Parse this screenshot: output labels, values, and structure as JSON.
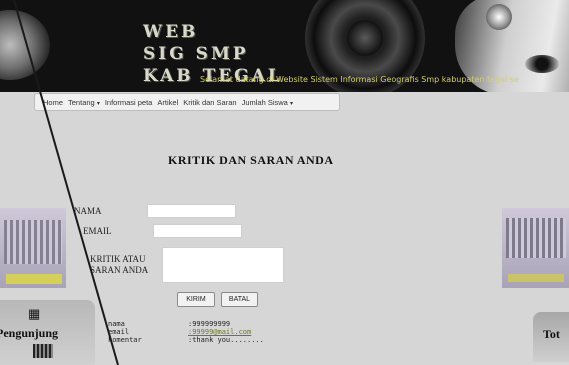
{
  "header": {
    "logo_line1": "WEB",
    "logo_line2": "SIG SMP",
    "logo_line3": "KAB TEGAL",
    "tagline": "Selamat datang di Website Sistem Informasi Geografis Smp kabupaten tegal  se"
  },
  "nav": {
    "items": [
      {
        "label": "Home",
        "caret": false
      },
      {
        "label": "Tentang",
        "caret": true
      },
      {
        "label": "Informasi peta",
        "caret": false
      },
      {
        "label": "Artikel",
        "caret": false
      },
      {
        "label": "Kritik dan Saran",
        "caret": false
      },
      {
        "label": "Jumlah Siswa",
        "caret": true
      }
    ],
    "caret_glyph": "▾"
  },
  "main": {
    "title": "KRITIK DAN SARAN ANDA",
    "form": {
      "nama_label": "NAMA",
      "email_label": "EMAIL",
      "kritik_label_line1": "KRITIK ATAU",
      "kritik_label_line2": "SARAN ANDA",
      "nama_value": "",
      "email_value": "",
      "kritik_value": "",
      "submit_label": "KIRIM",
      "cancel_label": "BATAL"
    },
    "comment": {
      "nama_key": "nama",
      "nama_value": ":999999999",
      "email_key": "email",
      "email_value": ":99999@mail.com",
      "komentar_key": "komentar",
      "komentar_value": ":thank you........"
    }
  },
  "sidebar": {
    "left_visitor_label": "Pengunjung",
    "right_visitor_label": "Tot"
  },
  "colors": {
    "banner": "#111111",
    "page_bg": "#d6d6d6",
    "tagline": "#d4d06a",
    "link": "#6b7a1e"
  },
  "icons": {
    "nav_caret": "chevron-down-icon",
    "visitor": "visitor-icon",
    "resize": "resize-handle-icon"
  }
}
